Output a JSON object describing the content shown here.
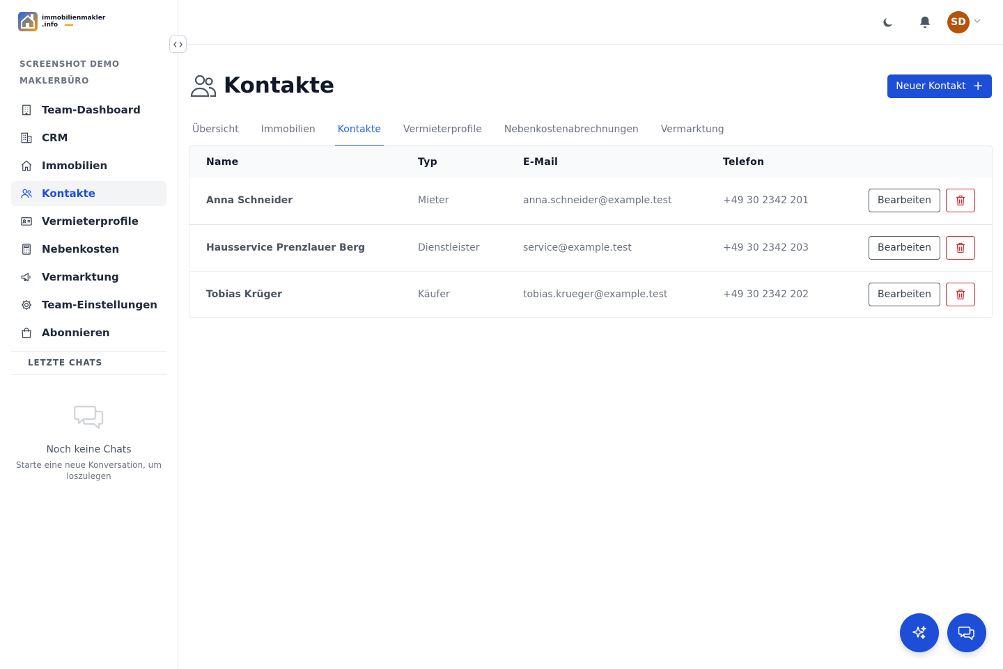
{
  "brand": {
    "line1": "immobilienmakler",
    "line2": ".info"
  },
  "org_name": "SCREENSHOT DEMO MAKLERBÜRO",
  "sidebar": {
    "items": [
      {
        "label": "Team-Dashboard",
        "icon": "building-icon"
      },
      {
        "label": "CRM",
        "icon": "office-building-icon"
      },
      {
        "label": "Immobilien",
        "icon": "home-icon"
      },
      {
        "label": "Kontakte",
        "icon": "users-icon",
        "active": true
      },
      {
        "label": "Vermieterprofile",
        "icon": "id-card-icon"
      },
      {
        "label": "Nebenkosten",
        "icon": "calculator-icon"
      },
      {
        "label": "Vermarktung",
        "icon": "megaphone-icon"
      },
      {
        "label": "Team-Einstellungen",
        "icon": "cog-icon"
      },
      {
        "label": "Abonnieren",
        "icon": "shopping-bag-icon"
      }
    ],
    "chats_heading": "LETZTE CHATS",
    "empty_title": "Noch keine Chats",
    "empty_sub": "Starte eine neue Konversation, um loszulegen"
  },
  "header": {
    "avatar_initials": "SD"
  },
  "page": {
    "title": "Kontakte",
    "new_button": "Neuer Kontakt"
  },
  "tabs": [
    {
      "label": "Übersicht"
    },
    {
      "label": "Immobilien"
    },
    {
      "label": "Kontakte",
      "active": true
    },
    {
      "label": "Vermieterprofile"
    },
    {
      "label": "Nebenkostenabrechnungen"
    },
    {
      "label": "Vermarktung"
    }
  ],
  "table": {
    "headers": {
      "name": "Name",
      "type": "Typ",
      "email": "E-Mail",
      "phone": "Telefon"
    },
    "rows": [
      {
        "name": "Anna Schneider",
        "type": "Mieter",
        "email": "anna.schneider@example.test",
        "phone": "+49 30 2342 201"
      },
      {
        "name": "Hausservice Prenzlauer Berg",
        "type": "Dienstleister",
        "email": "service@example.test",
        "phone": "+49 30 2342 203"
      },
      {
        "name": "Tobias Krüger",
        "type": "Käufer",
        "email": "tobias.krueger@example.test",
        "phone": "+49 30 2342 202"
      }
    ],
    "edit_label": "Bearbeiten"
  },
  "colors": {
    "primary": "#1d4ed8",
    "danger": "#dc2626",
    "avatar": "#b45309",
    "brand_accent": "#f59e0b"
  }
}
